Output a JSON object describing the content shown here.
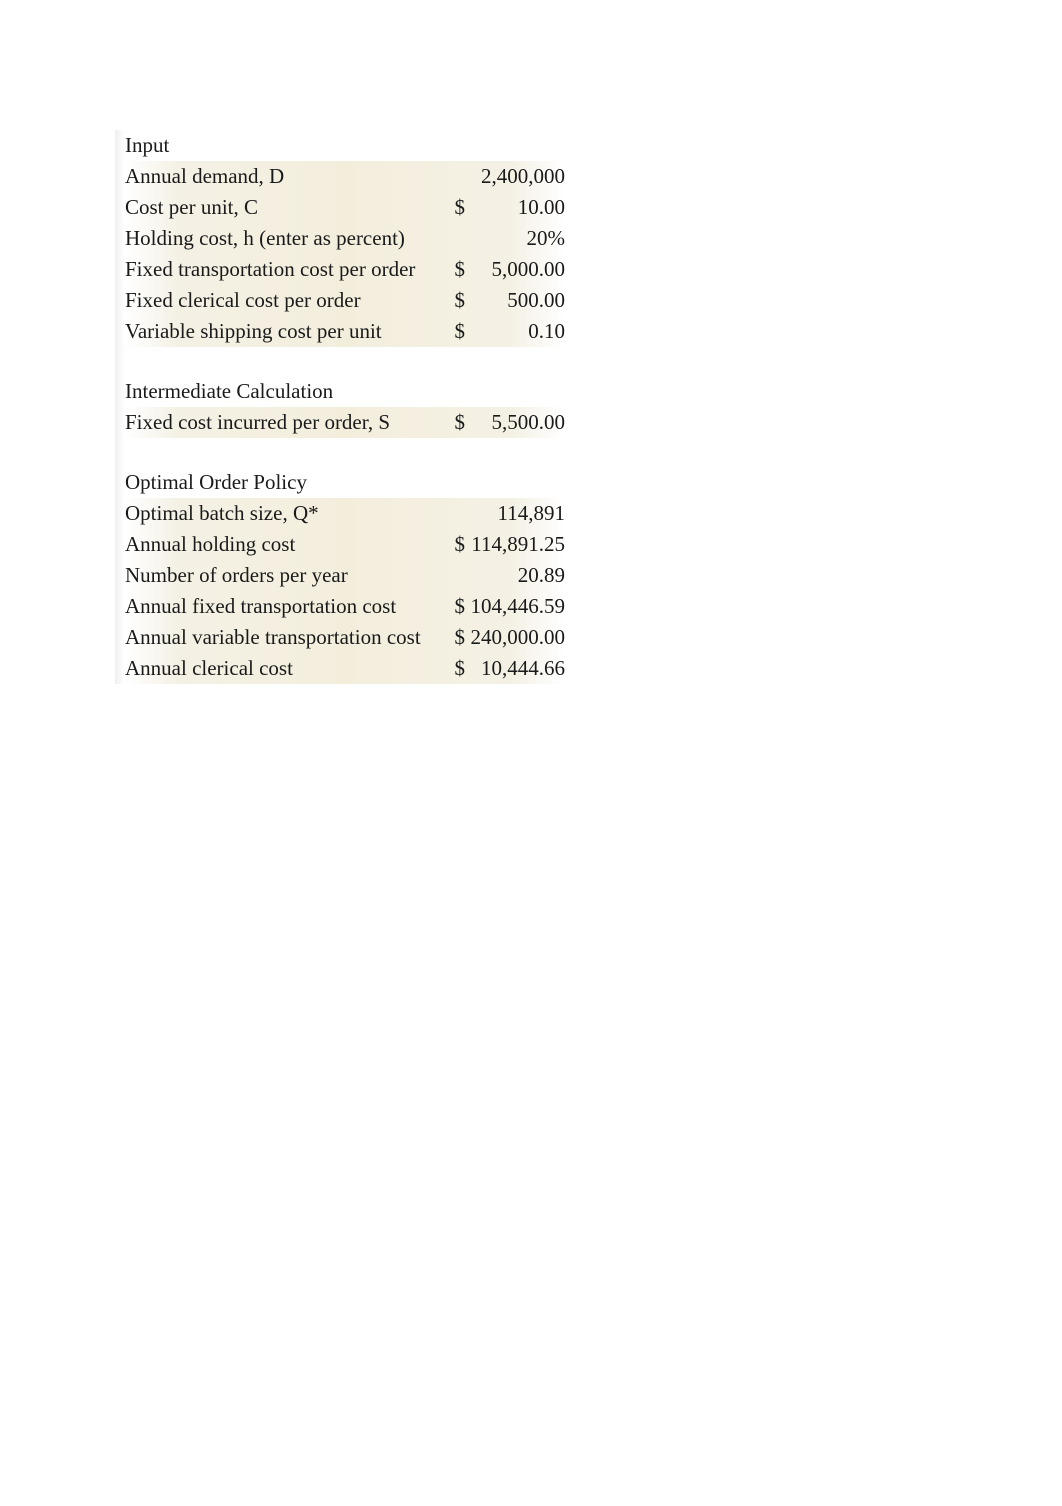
{
  "sections": {
    "input": {
      "title": "Input",
      "rows": [
        {
          "label": "Annual demand, D",
          "symbol": "",
          "value": "2,400,000"
        },
        {
          "label": "Cost per unit, C",
          "symbol": "$",
          "value": "10.00"
        },
        {
          "label": "Holding cost, h (enter as percent)",
          "symbol": "",
          "value": "20%"
        },
        {
          "label": "Fixed transportation cost per order",
          "symbol": "$",
          "value": "5,000.00"
        },
        {
          "label": "Fixed clerical cost per order",
          "symbol": "$",
          "value": "500.00"
        },
        {
          "label": "Variable shipping cost per unit",
          "symbol": "$",
          "value": "0.10"
        }
      ]
    },
    "intermediate": {
      "title": "Intermediate Calculation",
      "rows": [
        {
          "label": "Fixed cost incurred per order, S",
          "symbol": "$",
          "value": "5,500.00"
        }
      ]
    },
    "optimal": {
      "title": "Optimal Order Policy",
      "rows": [
        {
          "label": "Optimal batch size, Q*",
          "symbol": "",
          "value": "114,891"
        },
        {
          "label": "Annual holding cost",
          "symbol": "$",
          "value": "114,891.25"
        },
        {
          "label": "Number of orders per year",
          "symbol": "",
          "value": "20.89"
        },
        {
          "label": "Annual fixed transportation cost",
          "symbol": "$",
          "value": "104,446.59"
        },
        {
          "label": "Annual variable transportation cost",
          "symbol": "$",
          "value": "240,000.00"
        },
        {
          "label": "Annual clerical cost",
          "symbol": "$",
          "value": "10,444.66"
        }
      ]
    }
  }
}
